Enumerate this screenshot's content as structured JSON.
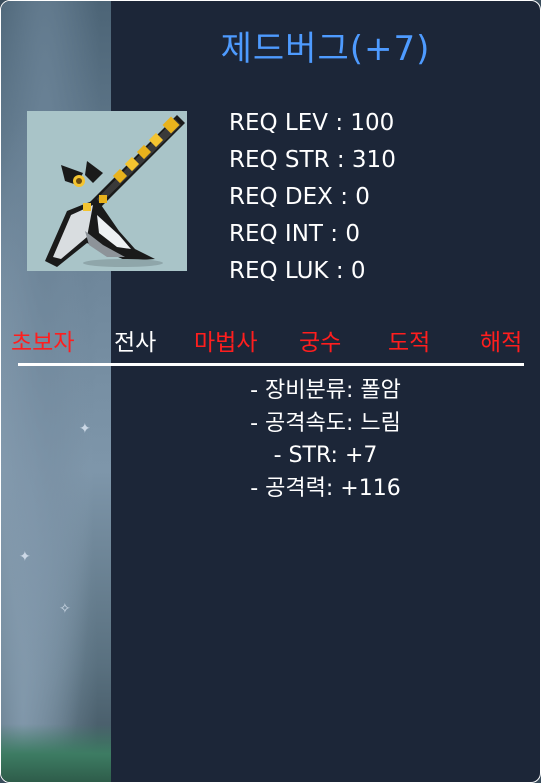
{
  "item": {
    "name": "제드버그(+7)",
    "icon": "polearm-icon",
    "name_color": "#4e9bff"
  },
  "requirements": [
    {
      "label": "REQ LEV : 100"
    },
    {
      "label": "REQ STR : 310"
    },
    {
      "label": "REQ DEX : 0"
    },
    {
      "label": "REQ INT : 0"
    },
    {
      "label": "REQ LUK : 0"
    }
  ],
  "jobs": [
    {
      "label": "초보자",
      "allowed": false
    },
    {
      "label": "전사",
      "allowed": true
    },
    {
      "label": "마법사",
      "allowed": false
    },
    {
      "label": "궁수",
      "allowed": false
    },
    {
      "label": "도적",
      "allowed": false
    },
    {
      "label": "해적",
      "allowed": false
    }
  ],
  "colors": {
    "job_disallowed": "#ff1e1e",
    "job_allowed": "#ffffff",
    "panel_bg": "#1c2638"
  },
  "stats": [
    {
      "label": "- 장비분류: 폴암"
    },
    {
      "label": "- 공격속도: 느림"
    },
    {
      "label": "- STR: +7"
    },
    {
      "label": "- 공격력: +116"
    }
  ]
}
